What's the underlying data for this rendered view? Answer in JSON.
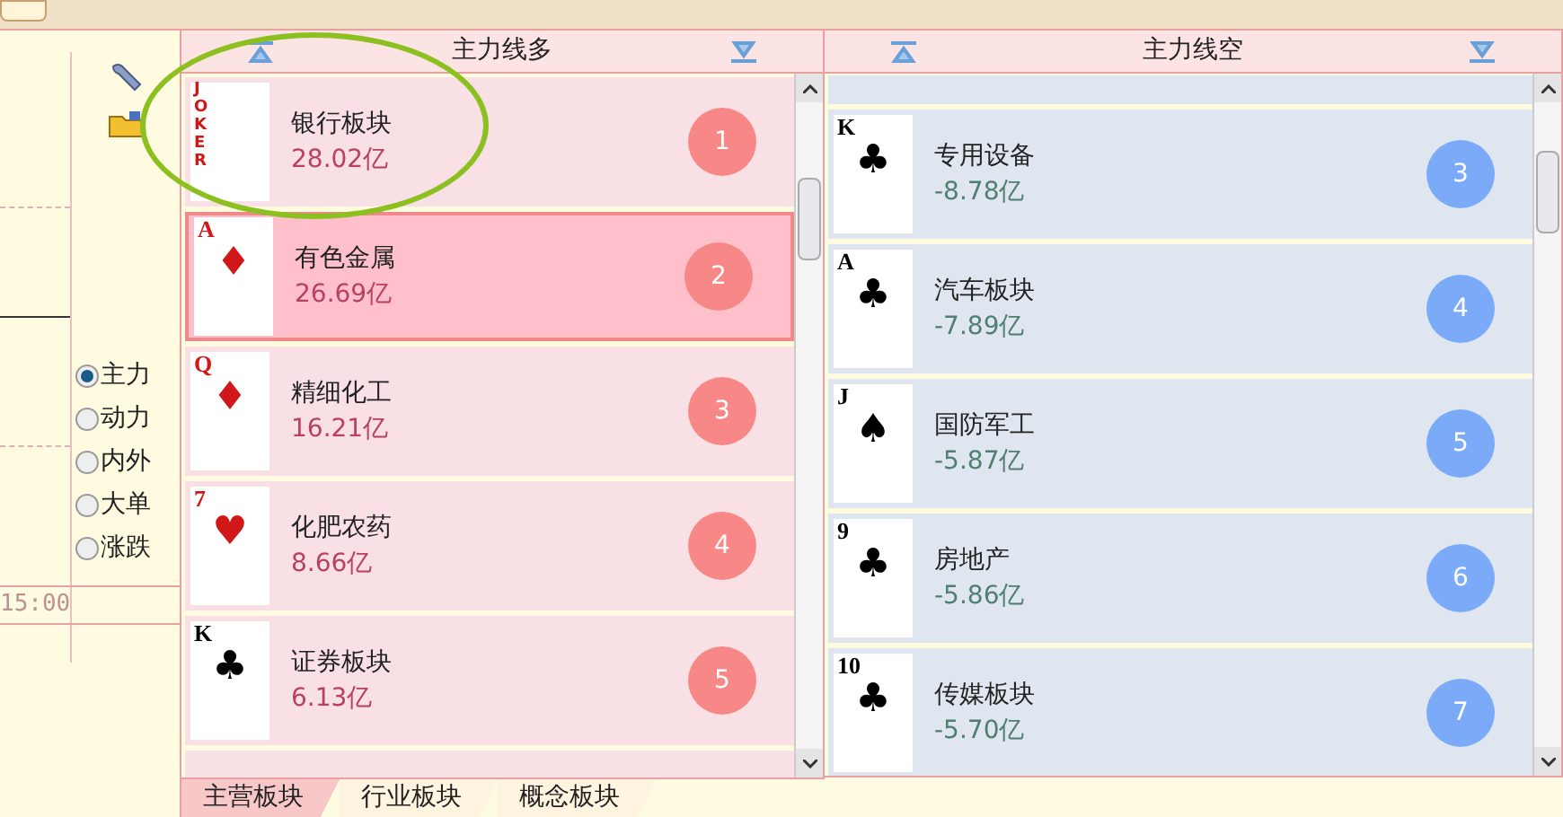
{
  "time_label": "15:00",
  "radios": [
    {
      "label": "主力",
      "selected": true
    },
    {
      "label": "动力",
      "selected": false
    },
    {
      "label": "内外",
      "selected": false
    },
    {
      "label": "大单",
      "selected": false
    },
    {
      "label": "涨跌",
      "selected": false
    }
  ],
  "long_panel": {
    "title": "主力线多",
    "items": [
      {
        "rank": "JOKER",
        "red": true,
        "name": "银行板块",
        "amount": "28.02亿",
        "badge": "1",
        "selected": false
      },
      {
        "rank": "A",
        "suit": "♦",
        "red": true,
        "name": "有色金属",
        "amount": "26.69亿",
        "badge": "2",
        "selected": true
      },
      {
        "rank": "Q",
        "suit": "♦",
        "red": true,
        "name": "精细化工",
        "amount": "16.21亿",
        "badge": "3",
        "selected": false
      },
      {
        "rank": "7",
        "suit": "♥",
        "red": true,
        "name": "化肥农药",
        "amount": "8.66亿",
        "badge": "4",
        "selected": false
      },
      {
        "rank": "K",
        "suit": "♣",
        "red": false,
        "name": "证券板块",
        "amount": "6.13亿",
        "badge": "5",
        "selected": false
      }
    ]
  },
  "short_panel": {
    "title": "主力线空",
    "items": [
      {
        "rank": "K",
        "suit": "♣",
        "red": false,
        "name": "专用设备",
        "amount": "-8.78亿",
        "badge": "3",
        "selected": false
      },
      {
        "rank": "A",
        "suit": "♣",
        "red": false,
        "name": "汽车板块",
        "amount": "-7.89亿",
        "badge": "4",
        "selected": false
      },
      {
        "rank": "J",
        "suit": "♠",
        "red": false,
        "name": "国防军工",
        "amount": "-5.87亿",
        "badge": "5",
        "selected": false
      },
      {
        "rank": "9",
        "suit": "♣",
        "red": false,
        "name": "房地产",
        "amount": "-5.86亿",
        "badge": "6",
        "selected": false
      },
      {
        "rank": "10",
        "suit": "♣",
        "red": false,
        "name": "传媒板块",
        "amount": "-5.70亿",
        "badge": "7",
        "selected": false
      }
    ]
  },
  "tabs": [
    {
      "label": "主营板块",
      "selected": true
    },
    {
      "label": "行业板块",
      "selected": false
    },
    {
      "label": "概念板块",
      "selected": false
    }
  ]
}
